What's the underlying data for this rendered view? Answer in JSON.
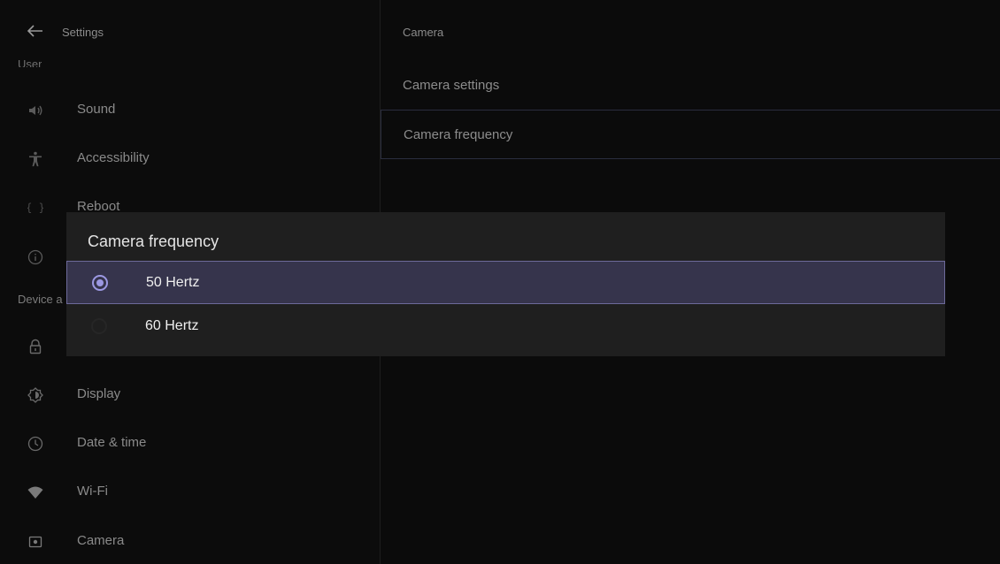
{
  "left_header": {
    "title": "Settings"
  },
  "sections": {
    "user": "User",
    "device": "Device a"
  },
  "nav_items": [
    {
      "label": "Sound",
      "icon": "volume-icon"
    },
    {
      "label": "Accessibility",
      "icon": "accessibility-icon"
    },
    {
      "label": "Reboot",
      "icon": "braces-icon"
    },
    {
      "label": "",
      "icon": "info-icon"
    },
    {
      "label": "",
      "icon": "lock-icon"
    },
    {
      "label": "Display",
      "icon": "brightness-icon"
    },
    {
      "label": "Date & time",
      "icon": "clock-icon"
    },
    {
      "label": "Wi-Fi",
      "icon": "wifi-icon"
    },
    {
      "label": "Camera",
      "icon": "camera-icon"
    }
  ],
  "right_panel": {
    "title": "Camera",
    "items": [
      {
        "label": "Camera settings"
      },
      {
        "label": "Camera frequency"
      }
    ]
  },
  "dialog": {
    "title": "Camera frequency",
    "options": [
      {
        "label": "50 Hertz",
        "selected": true
      },
      {
        "label": "60 Hertz",
        "selected": false
      }
    ]
  },
  "colors": {
    "accent": "#9c98e2",
    "selected_row_bg": "#36344c",
    "dialog_bg": "#1f1f1f",
    "background": "#0b0b0b"
  }
}
